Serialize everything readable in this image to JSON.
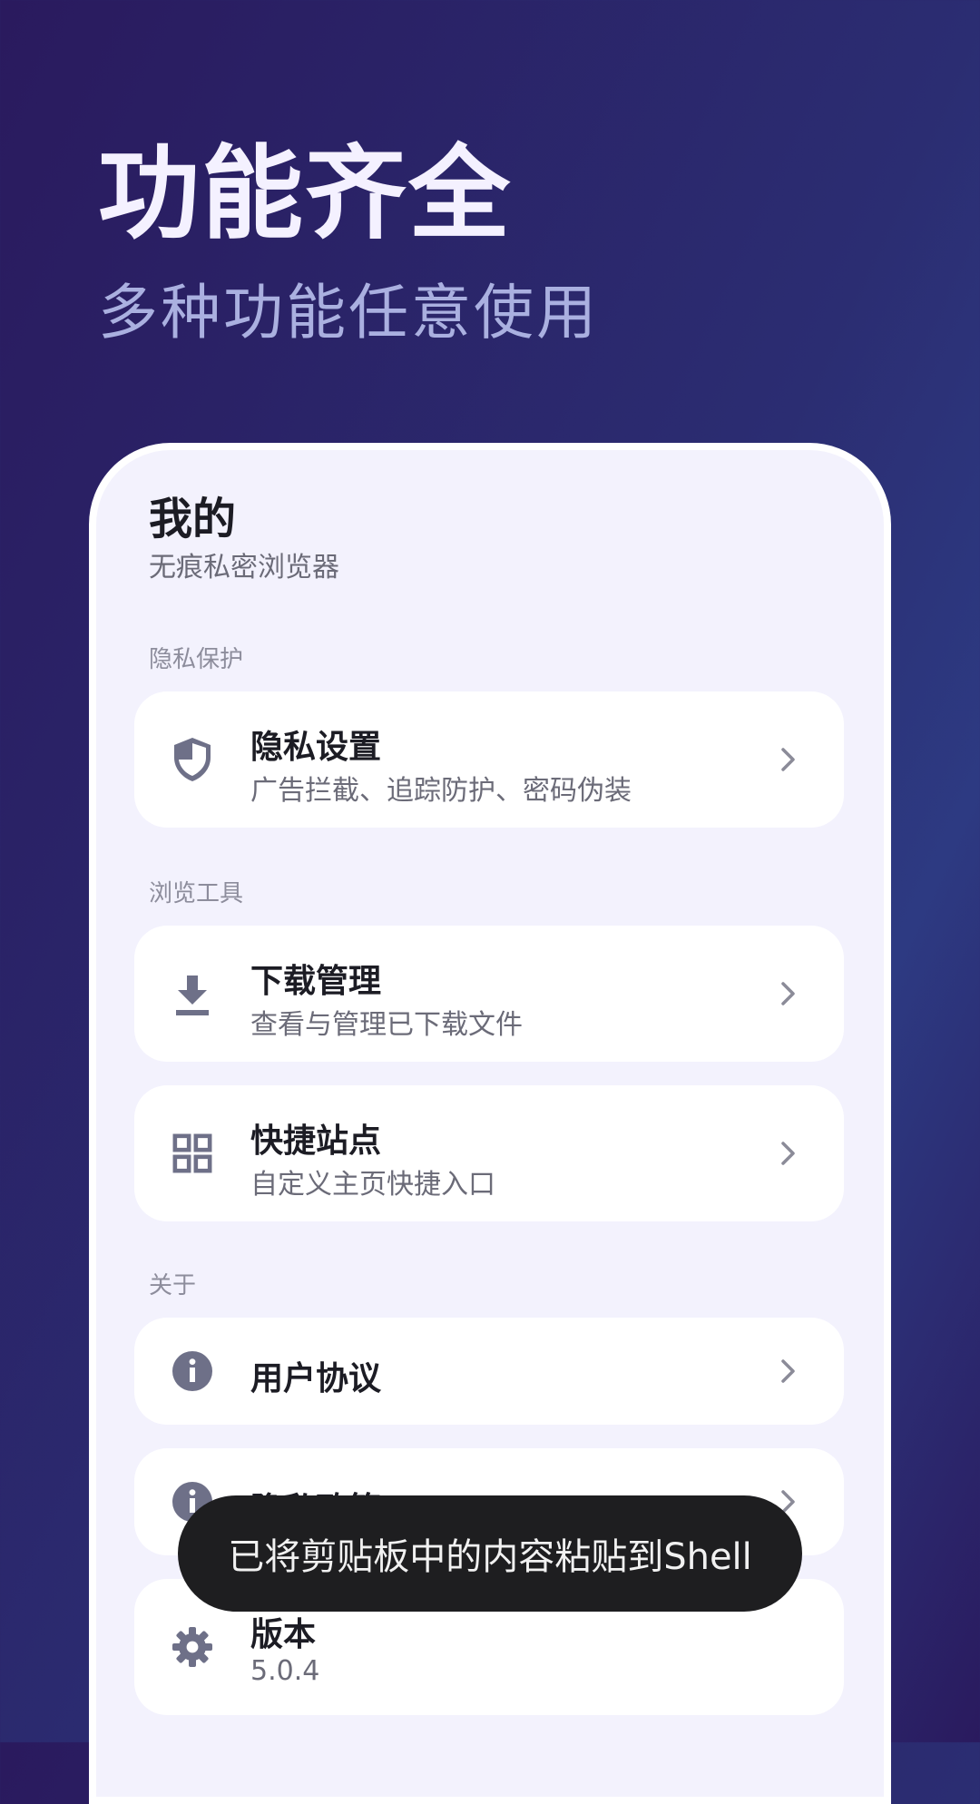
{
  "hero": {
    "title": "功能齐全",
    "subtitle": "多种功能任意使用"
  },
  "page": {
    "title": "我的",
    "subtitle": "无痕私密浏览器"
  },
  "sections": [
    {
      "label": "隐私保护"
    },
    {
      "label": "浏览工具"
    },
    {
      "label": "关于"
    }
  ],
  "items": [
    {
      "icon": "shield-icon",
      "title": "隐私设置",
      "desc": "广告拦截、追踪防护、密码伪装"
    },
    {
      "icon": "download-icon",
      "title": "下载管理",
      "desc": "查看与管理已下载文件"
    },
    {
      "icon": "grid-icon",
      "title": "快捷站点",
      "desc": "自定义主页快捷入口"
    },
    {
      "icon": "info-icon",
      "title": "用户协议"
    },
    {
      "icon": "info-icon",
      "title": "隐私政策"
    },
    {
      "icon": "gear-icon",
      "title": "版本",
      "desc": "5.0.4"
    }
  ],
  "toast": {
    "text": "已将剪贴板中的内容粘贴到Shell"
  },
  "colors": {
    "icon": "#6e7088",
    "chevron": "#8b8b98",
    "toast_bg": "#1e1e20"
  }
}
